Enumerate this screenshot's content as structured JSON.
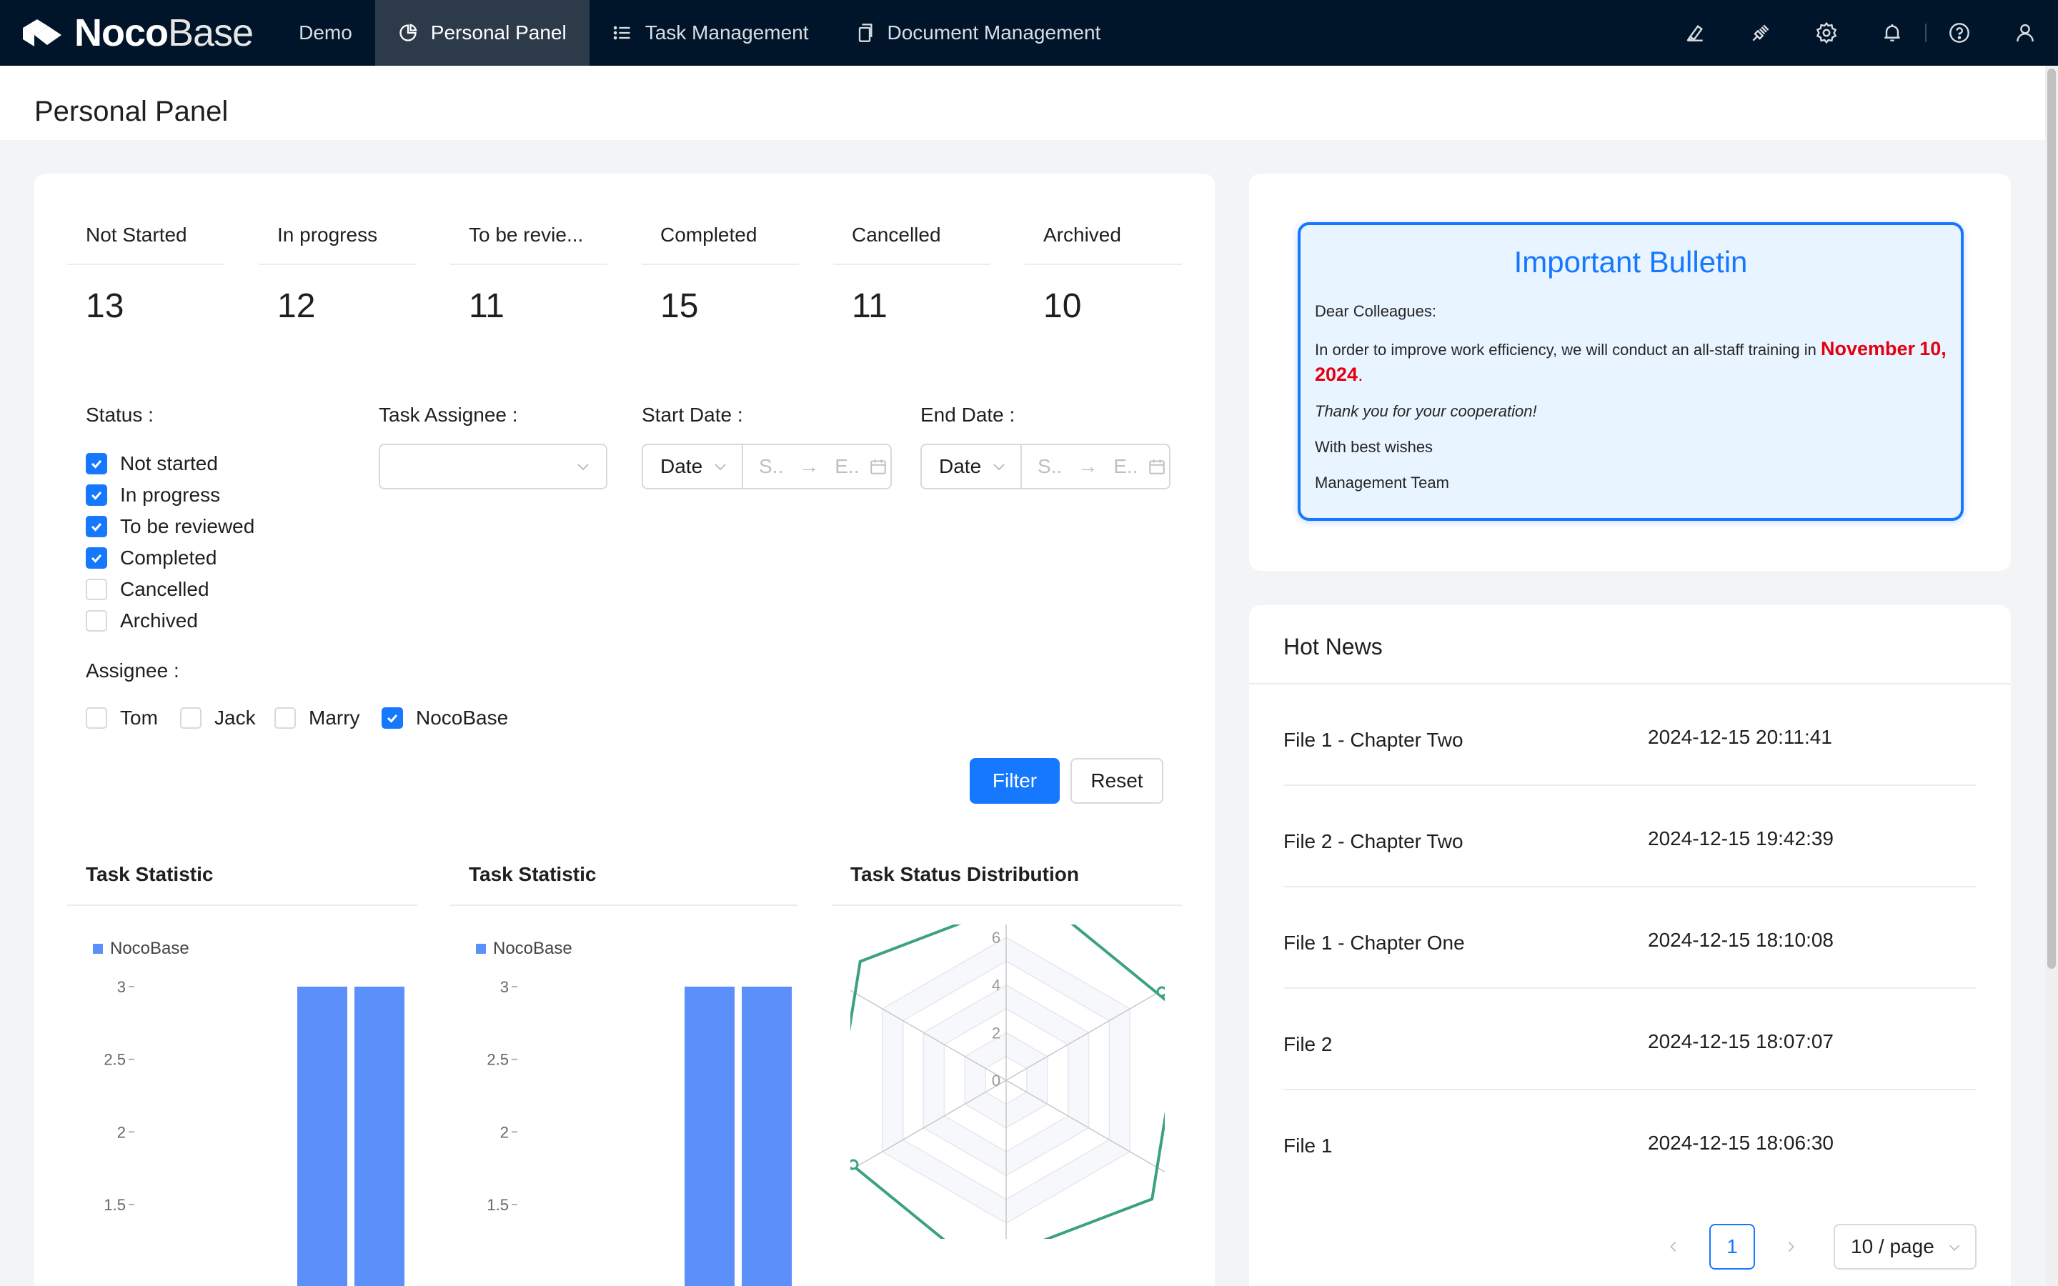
{
  "app": {
    "logo_bold": "Noco",
    "logo_light": "Base"
  },
  "nav": {
    "items": [
      {
        "label": "Demo",
        "icon": "none"
      },
      {
        "label": "Personal Panel",
        "icon": "pie-chart-icon"
      },
      {
        "label": "Task Management",
        "icon": "list-icon"
      },
      {
        "label": "Document Management",
        "icon": "copy-icon"
      }
    ],
    "active": "Personal Panel"
  },
  "topbar_icons": [
    "highlight-icon",
    "plugin-icon",
    "gear-icon",
    "bell-icon",
    "help-icon",
    "user-icon"
  ],
  "page": {
    "title": "Personal Panel"
  },
  "stats": [
    {
      "title": "Not Started",
      "value": "13"
    },
    {
      "title": "In progress",
      "value": "12"
    },
    {
      "title": "To be revie...",
      "value": "11"
    },
    {
      "title": "Completed",
      "value": "15"
    },
    {
      "title": "Cancelled",
      "value": "11"
    },
    {
      "title": "Archived",
      "value": "10"
    }
  ],
  "filter": {
    "status_label": "Status",
    "status_options": [
      {
        "label": "Not started",
        "checked": true
      },
      {
        "label": "In progress",
        "checked": true
      },
      {
        "label": "To be reviewed",
        "checked": true
      },
      {
        "label": "Completed",
        "checked": true
      },
      {
        "label": "Cancelled",
        "checked": false
      },
      {
        "label": "Archived",
        "checked": false
      }
    ],
    "task_assignee_label": "Task Assignee",
    "task_assignee_value": "",
    "start_date_label": "Start Date",
    "end_date_label": "End Date",
    "date_picker_value": "Date",
    "range_start_placeholder": "S..",
    "range_end_placeholder": "E..",
    "range_separator": "→",
    "assignee_label": "Assignee",
    "assignee_options": [
      {
        "label": "Tom",
        "checked": false
      },
      {
        "label": "Jack",
        "checked": false
      },
      {
        "label": "Marry",
        "checked": false
      },
      {
        "label": "NocoBase",
        "checked": true
      }
    ],
    "filter_button": "Filter",
    "reset_button": "Reset",
    "colon": ":"
  },
  "charts": {
    "headers": [
      "Task Statistic",
      "Task Statistic",
      "Task Status Distribution"
    ]
  },
  "chart_data": [
    {
      "type": "bar",
      "title": "Task Statistic",
      "categories": [
        "",
        ""
      ],
      "series": [
        {
          "name": "NocoBase",
          "values": [
            3,
            3
          ]
        }
      ],
      "y_ticks": [
        "3",
        "2.5",
        "2",
        "1.5"
      ],
      "ylim": [
        1.5,
        3
      ],
      "color": "#5b8ff9"
    },
    {
      "type": "bar",
      "title": "Task Statistic",
      "categories": [
        "",
        ""
      ],
      "series": [
        {
          "name": "NocoBase",
          "values": [
            3,
            3
          ]
        }
      ],
      "y_ticks": [
        "3",
        "2.5",
        "2",
        "1.5"
      ],
      "ylim": [
        1.5,
        3
      ],
      "color": "#5b8ff9"
    },
    {
      "type": "radar",
      "title": "Task Status Distribution",
      "radial_ticks": [
        "6",
        "4",
        "2",
        "0"
      ],
      "rlim": [
        0,
        6
      ],
      "color": "#3aa37e"
    }
  ],
  "bulletin": {
    "title": "Important Bulletin",
    "greeting": "Dear Colleagues:",
    "body_prefix": "In order to improve work efficiency, we will conduct an all-staff training in ",
    "body_highlight_1": "November",
    "body_highlight_2": "10, 2024",
    "body_suffix": ".",
    "thanks": "Thank you for your cooperation!",
    "closing": "With best wishes",
    "signature": "Management Team"
  },
  "news": {
    "title": "Hot News",
    "items": [
      {
        "name": "File 1 - Chapter Two",
        "time": "2024-12-15 20:11:41"
      },
      {
        "name": "File 2 - Chapter Two",
        "time": "2024-12-15 19:42:39"
      },
      {
        "name": "File 1 - Chapter One",
        "time": "2024-12-15 18:10:08"
      },
      {
        "name": "File 2",
        "time": "2024-12-15 18:07:07"
      },
      {
        "name": "File 1",
        "time": "2024-12-15 18:06:30"
      }
    ],
    "pagination": {
      "current_page": "1",
      "page_size": "10 / page"
    }
  }
}
